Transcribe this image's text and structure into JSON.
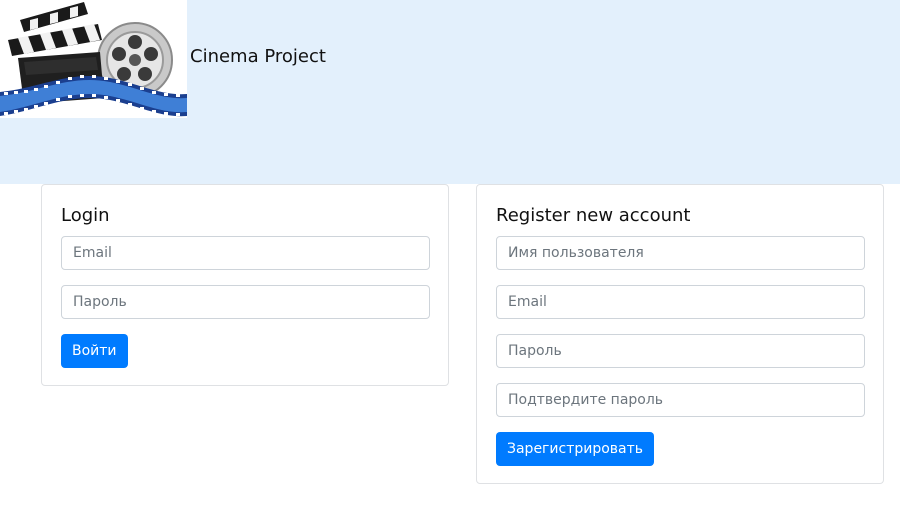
{
  "header": {
    "brand": "Cinema Project",
    "logo_icon": "film-clapperboard-reel-logo"
  },
  "login": {
    "title": "Login",
    "email_placeholder": "Email",
    "password_placeholder": "Пароль",
    "submit_label": "Войти"
  },
  "register": {
    "title": "Register new account",
    "username_placeholder": "Имя пользователя",
    "email_placeholder": "Email",
    "password_placeholder": "Пароль",
    "confirm_placeholder": "Подтвердите пароль",
    "submit_label": "Зарегистрировать"
  },
  "colors": {
    "header_bg": "#e3f0fc",
    "primary": "#007bff"
  }
}
